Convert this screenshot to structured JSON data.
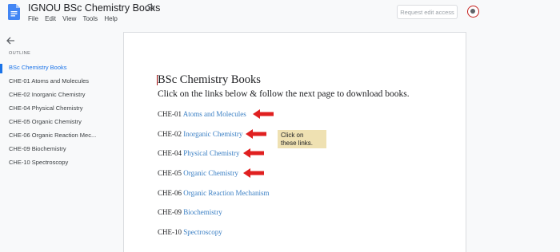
{
  "app": {
    "title": "IGNOU BSc Chemistry Books",
    "menu": [
      "File",
      "Edit",
      "View",
      "Tools",
      "Help"
    ],
    "request_edit_label": "Request edit access"
  },
  "icons": {
    "doc": "docs-icon",
    "cloud": "cloud-status-icon",
    "back": "back-arrow-icon",
    "avatar": "account-avatar"
  },
  "colors": {
    "link": "#3a7fc4",
    "accent": "#1a73e8",
    "arrow": "#e02020",
    "callout": "#efe1b2"
  },
  "outline": {
    "heading": "OUTLINE",
    "items": [
      {
        "label": "BSc Chemistry Books",
        "active": true
      },
      {
        "label": "CHE-01 Atoms and Molecules"
      },
      {
        "label": "CHE-02 Inorganic Chemistry"
      },
      {
        "label": "CHE-04 Physical Chemistry"
      },
      {
        "label": "CHE-05 Organic Chemistry"
      },
      {
        "label": "CHE-06 Organic Reaction Mec..."
      },
      {
        "label": "CHE-09 Biochemistry"
      },
      {
        "label": "CHE-10 Spectroscopy"
      }
    ]
  },
  "document": {
    "heading": "BSc Chemistry Books",
    "subtitle": "Click on the links below & follow the next page to download books.",
    "books": [
      {
        "code": "CHE-01",
        "link": "Atoms and Molecules"
      },
      {
        "code": "CHE-02",
        "link": "Inorganic Chemistry"
      },
      {
        "code": "CHE-04",
        "link": "Physical Chemistry"
      },
      {
        "code": "CHE-05",
        "link": "Organic Chemistry"
      },
      {
        "code": "CHE-06",
        "link": "Organic Reaction Mechanism"
      },
      {
        "code": "CHE-09",
        "link": "Biochemistry"
      },
      {
        "code": "CHE-10",
        "link": "Spectroscopy"
      }
    ],
    "callout": {
      "line1": "Click on",
      "line2": "these links."
    }
  }
}
